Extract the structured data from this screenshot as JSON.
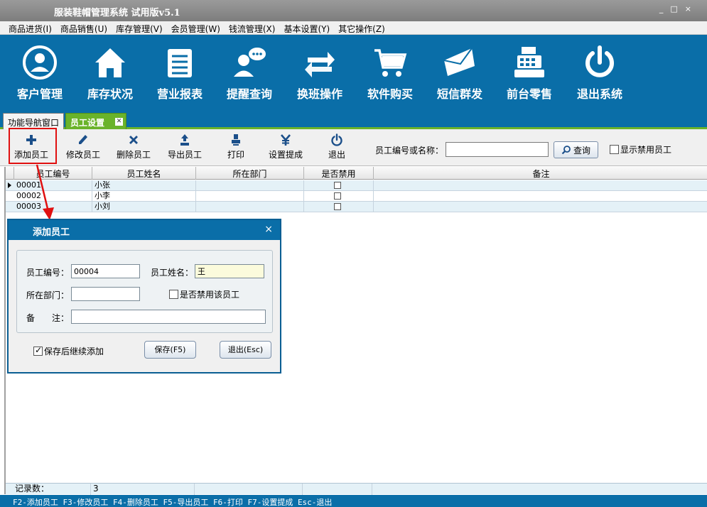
{
  "window": {
    "title": "服装鞋帽管理系统 试用版v5.1",
    "min": "_",
    "max": "□",
    "close": "×"
  },
  "menu": [
    "商品进货(I)",
    "商品销售(U)",
    "库存管理(V)",
    "会员管理(W)",
    "钱流管理(X)",
    "基本设置(Y)",
    "其它操作(Z)"
  ],
  "mainbar": [
    {
      "label": "客户管理",
      "icon": "customer-icon"
    },
    {
      "label": "库存状况",
      "icon": "house-icon"
    },
    {
      "label": "营业报表",
      "icon": "report-icon"
    },
    {
      "label": "提醒查询",
      "icon": "chat-user-icon"
    },
    {
      "label": "换班操作",
      "icon": "swap-icon"
    },
    {
      "label": "软件购买",
      "icon": "cart-icon"
    },
    {
      "label": "短信群发",
      "icon": "mail-icon"
    },
    {
      "label": "前台零售",
      "icon": "cash-register-icon"
    },
    {
      "label": "退出系统",
      "icon": "power-icon"
    }
  ],
  "tabs": [
    {
      "label": "功能导航窗口"
    },
    {
      "label": "员工设置",
      "close": "✕"
    }
  ],
  "toolbar": {
    "buttons": [
      {
        "label": "添加员工",
        "icon": "plus-icon"
      },
      {
        "label": "修改员工",
        "icon": "pencil-icon"
      },
      {
        "label": "删除员工",
        "icon": "x-icon"
      },
      {
        "label": "导出员工",
        "icon": "export-icon"
      },
      {
        "label": "打印",
        "icon": "print-icon"
      },
      {
        "label": "设置提成",
        "icon": "yen-icon"
      },
      {
        "label": "退出",
        "icon": "power-icon"
      }
    ],
    "search_label": "员工编号或名称：",
    "search_value": "",
    "query_label": "查询",
    "show_disabled_label": "显示禁用员工"
  },
  "grid": {
    "columns": [
      "员工编号",
      "员工姓名",
      "所在部门",
      "是否禁用",
      "备注"
    ],
    "rows": [
      {
        "id": "00001",
        "name": "小张",
        "dept": "",
        "disabled": false,
        "note": ""
      },
      {
        "id": "00002",
        "name": "小李",
        "dept": "",
        "disabled": false,
        "note": ""
      },
      {
        "id": "00003",
        "name": "小刘",
        "dept": "",
        "disabled": false,
        "note": ""
      }
    ],
    "footer_label": "记录数：",
    "footer_count": "3"
  },
  "statusbar": "F2-添加员工 F3-修改员工 F4-删除员工 F5-导出员工 F6-打印 F7-设置提成 Esc-退出",
  "dialog": {
    "title": "添加员工",
    "close": "×",
    "id_label": "员工编号：",
    "id_value": "00004",
    "name_label": "员工姓名：",
    "name_value": "王",
    "dept_label": "所在部门：",
    "dept_value": "",
    "disable_label": "是否禁用该员工",
    "disable_checked": false,
    "note_label_a": "备",
    "note_label_b": "注：",
    "note_value": "",
    "continue_label": "保存后继续添加",
    "continue_checked": true,
    "save_label": "保存(F5)",
    "exit_label": "退出(Esc)"
  },
  "colors": {
    "brand_blue": "#0a6ea8",
    "tab_green": "#6ab32a",
    "highlight_red": "#e01010"
  }
}
